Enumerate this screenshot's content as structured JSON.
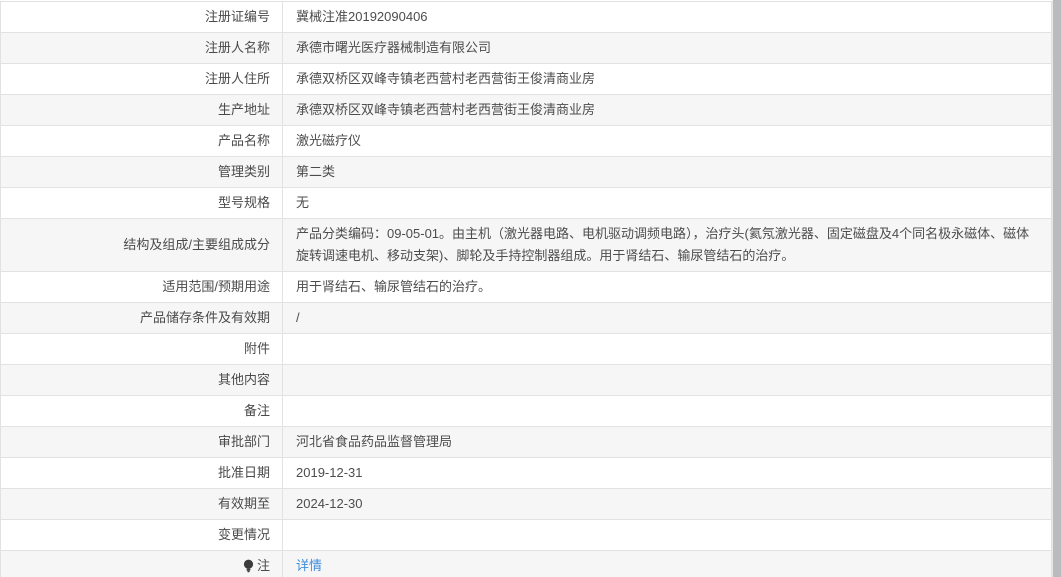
{
  "page": {
    "link_color": "#3e8ddc",
    "stripe_color": "#f6f6f7",
    "border_color": "#e2e2e2"
  },
  "table": {
    "rows": [
      {
        "label": "注册证编号",
        "value": "冀械注准20192090406"
      },
      {
        "label": "注册人名称",
        "value": "承德市曙光医疗器械制造有限公司"
      },
      {
        "label": "注册人住所",
        "value": "承德双桥区双峰寺镇老西营村老西营街王俊清商业房"
      },
      {
        "label": "生产地址",
        "value": "承德双桥区双峰寺镇老西营村老西营街王俊清商业房"
      },
      {
        "label": "产品名称",
        "value": "激光磁疗仪"
      },
      {
        "label": "管理类别",
        "value": "第二类"
      },
      {
        "label": "型号规格",
        "value": "无"
      },
      {
        "label": "结构及组成/主要组成成分",
        "value": "产品分类编码：09-05-01。由主机（激光器电路、电机驱动调频电路），治疗头(氦氖激光器、固定磁盘及4个同名极永磁体、磁体旋转调速电机、移动支架)、脚轮及手持控制器组成。用于肾结石、输尿管结石的治疗。"
      },
      {
        "label": "适用范围/预期用途",
        "value": "用于肾结石、输尿管结石的治疗。"
      },
      {
        "label": "产品储存条件及有效期",
        "value": "/"
      },
      {
        "label": "附件",
        "value": ""
      },
      {
        "label": "其他内容",
        "value": ""
      },
      {
        "label": "备注",
        "value": ""
      },
      {
        "label": "审批部门",
        "value": "河北省食品药品监督管理局"
      },
      {
        "label": "批准日期",
        "value": "2019-12-31"
      },
      {
        "label": "有效期至",
        "value": "2024-12-30"
      },
      {
        "label": "变更情况",
        "value": ""
      },
      {
        "label": "注",
        "value": "详情",
        "icon": "lightbulb-icon"
      }
    ]
  }
}
